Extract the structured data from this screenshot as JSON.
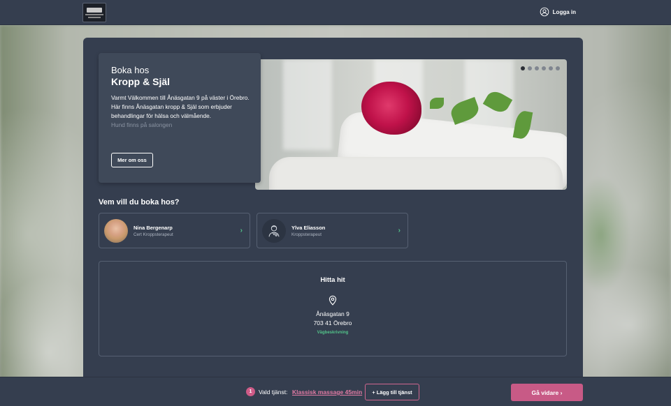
{
  "header": {
    "logo_alt": "Kropp & Själ",
    "login_label": "Logga in"
  },
  "hero": {
    "title_line1": "Boka hos",
    "title_line2": "Kropp & Själ",
    "description": "Varmt Välkommen till Ånäsgatan 9 på väster i Örebro. Här finns Ånäsgatan kropp & Själ som erbjuder behandlingar för hälsa och välmående.",
    "description_faded": "Hund finns på salongen",
    "about_button": "Mer om oss",
    "carousel": {
      "slides": 6,
      "active_index": 0
    }
  },
  "who": {
    "title": "Vem vill du boka hos?",
    "people": [
      {
        "name": "Nina Bergenarp",
        "role": "Cert Kroppsterapeut",
        "avatar": "photo"
      },
      {
        "name": "Ylva Eliasson",
        "role": "Kroppsterapeut",
        "avatar": "person-icon"
      }
    ]
  },
  "find": {
    "title": "Hitta hit",
    "street": "Ånäsgatan 9",
    "city": "703 41 Örebro",
    "directions": "Vägbeskrivning"
  },
  "footer": {
    "count": "1",
    "chosen_label": "Vald tjänst:",
    "chosen_value": "Klassisk massage 45min",
    "add_button": "+ Lägg till tjänst",
    "continue_button": "Gå vidare"
  },
  "colors": {
    "panel": "#353e4f",
    "accent_pink": "#c85a86",
    "accent_green": "#53c48a"
  }
}
